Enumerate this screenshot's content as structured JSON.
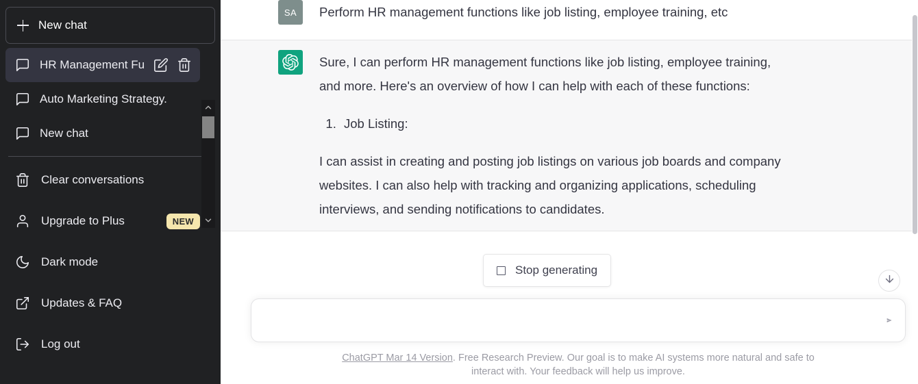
{
  "sidebar": {
    "new_chat": {
      "label": "New chat",
      "icon": "plus-icon"
    },
    "conversations": [
      {
        "label": "HR Management Fun",
        "icon": "chat-bubble-icon",
        "active": true,
        "actions": [
          {
            "name": "edit-icon"
          },
          {
            "name": "trash-icon"
          }
        ]
      },
      {
        "label": "Auto Marketing Strategy.",
        "icon": "chat-bubble-icon",
        "active": false
      },
      {
        "label": "New chat",
        "icon": "chat-bubble-icon",
        "active": false
      }
    ],
    "menu": [
      {
        "label": "Clear conversations",
        "icon": "trash-icon"
      },
      {
        "label": "Upgrade to Plus",
        "icon": "person-icon",
        "badge": "NEW"
      },
      {
        "label": "Dark mode",
        "icon": "moon-icon"
      },
      {
        "label": "Updates & FAQ",
        "icon": "external-link-icon"
      },
      {
        "label": "Log out",
        "icon": "logout-icon"
      }
    ],
    "scrollbar": {
      "up": "chevron-up-icon",
      "down": "chevron-down-icon"
    }
  },
  "chat": {
    "messages": [
      {
        "role": "user",
        "avatar_initials": "SA",
        "paragraphs": [
          "Perform HR management functions like job listing, employee training, etc"
        ]
      },
      {
        "role": "assistant",
        "avatar_icon": "chatgpt-logo-icon",
        "paragraphs": [
          "Sure, I can perform HR management functions like job listing, employee training, and more. Here's an overview of how I can help with each of these functions:",
          "I can assist in creating and posting job listings on various job boards and company websites. I can also help with tracking and organizing applications, scheduling interviews, and sending notifications to candidates."
        ],
        "list_items": [
          "Job Listing:"
        ]
      }
    ]
  },
  "stop_generating": {
    "label": "Stop generating",
    "icon": "stop-square-icon"
  },
  "scroll_down_button": {
    "icon": "arrow-down-icon"
  },
  "composer": {
    "value": "",
    "placeholder": "",
    "send_icon": "send-icon"
  },
  "footer": {
    "link": "ChatGPT Mar 14 Version",
    "text": ". Free Research Preview. Our goal is to make AI systems more natural and safe to interact with. Your feedback will help us improve."
  },
  "colors": {
    "sidebar_bg": "#202123",
    "sidebar_active": "#343541",
    "accent_green": "#10a37f",
    "badge_yellow": "#f5e6ad",
    "assistant_bg": "#f7f7f8",
    "user_avatar": "#7e8e8c"
  }
}
